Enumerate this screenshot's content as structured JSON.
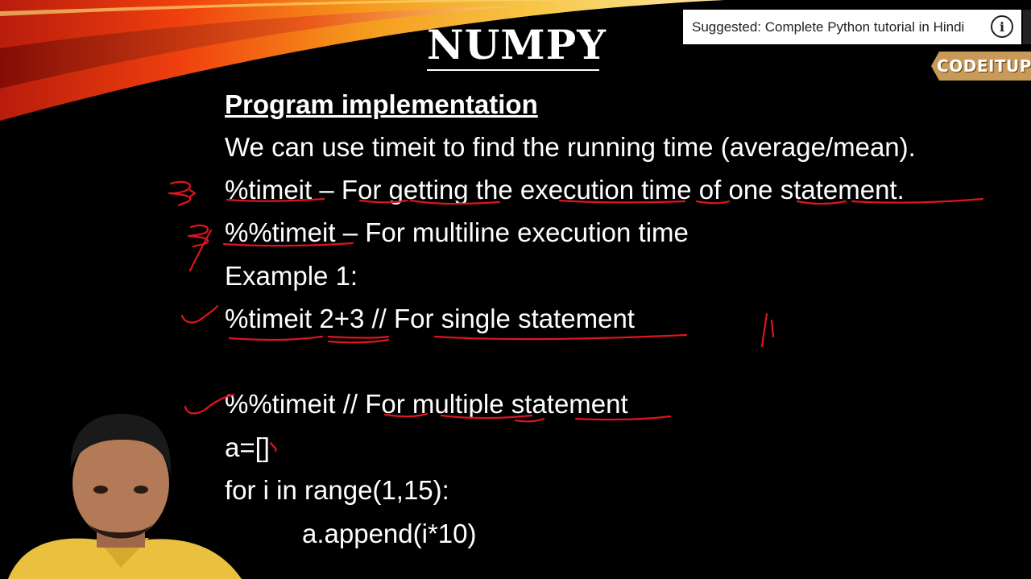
{
  "slide": {
    "title": "NUMPY",
    "heading": "Program implementation",
    "lines": [
      "We can use timeit to find the running time (average/mean).",
      "%timeit – For getting the execution time of one statement.",
      "%%timeit – For multiline execution time",
      "Example 1:",
      "%timeit 2+3 // For single statement",
      "%%timeit // For multiple statement",
      "a=[]",
      "for i in range(1,15):",
      "a.append(i*10)"
    ]
  },
  "overlay": {
    "suggestion_text": "Suggested: Complete Python tutorial in Hindi",
    "info_icon": "info-icon",
    "channel_logo": "CODEITUP"
  },
  "colors": {
    "background": "#000000",
    "annotation": "#e0141e",
    "logo_bg": "#c79a5a"
  }
}
